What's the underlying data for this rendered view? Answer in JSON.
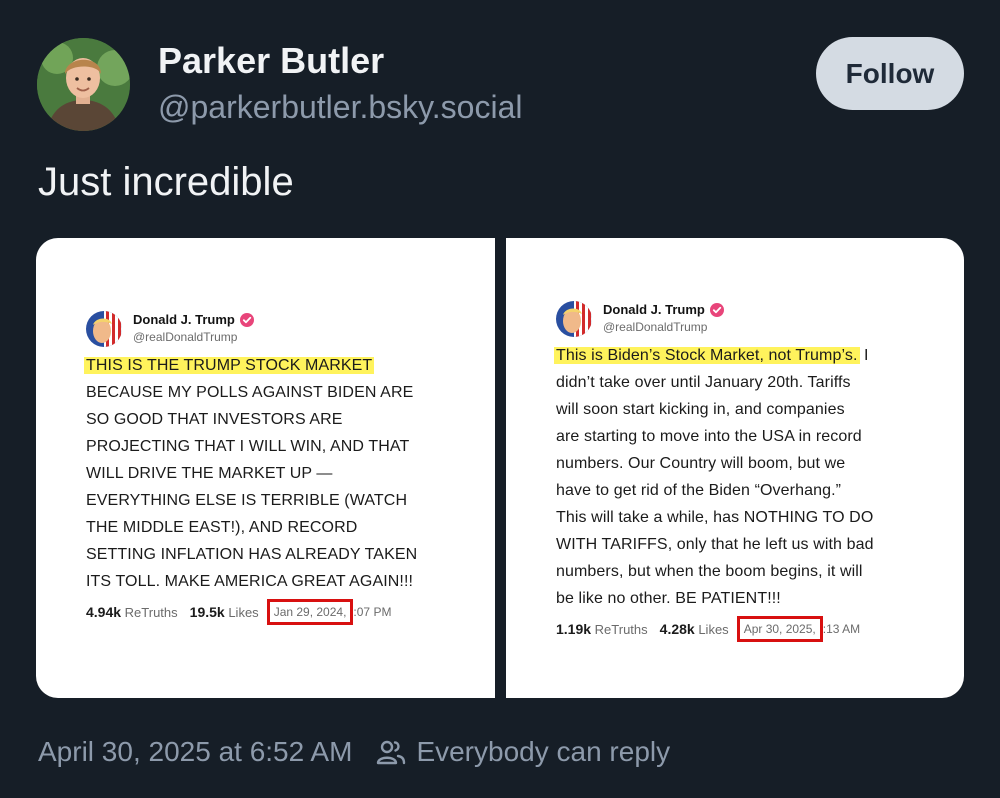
{
  "author": {
    "display_name": "Parker Butler",
    "handle": "@parkerbutler.bsky.social"
  },
  "follow_label": "Follow",
  "post_text": "Just incredible",
  "screenshots": [
    {
      "name": "Donald J. Trump",
      "handle": "@realDonaldTrump",
      "highlight": "THIS IS THE TRUMP STOCK MARKET",
      "body_lines": [
        "BECAUSE MY POLLS AGAINST BIDEN ARE",
        "SO GOOD THAT INVESTORS ARE",
        "PROJECTING THAT I WILL WIN, AND THAT",
        "WILL DRIVE THE MARKET UP —",
        "EVERYTHING ELSE IS TERRIBLE (WATCH",
        "THE MIDDLE EAST!), AND RECORD",
        "SETTING INFLATION HAS ALREADY TAKEN",
        "ITS TOLL. MAKE AMERICA GREAT AGAIN!!!"
      ],
      "retruths_count": "4.94k",
      "retruths_label": "ReTruths",
      "likes_count": "19.5k",
      "likes_label": "Likes",
      "date": "Jan 29, 2024,",
      "time_visible": ":07 PM"
    },
    {
      "name": "Donald J. Trump",
      "handle": "@realDonaldTrump",
      "highlight": "This is Biden’s Stock Market, not Trump’s.",
      "highlight_tail": " I",
      "body_lines": [
        "didn’t take over until January 20th. Tariffs",
        "will soon start kicking in, and companies",
        "are starting to move into the USA in record",
        "numbers. Our Country will boom, but we",
        "have to get rid of the Biden “Overhang.”",
        "This will take a while, has NOTHING TO DO",
        "WITH TARIFFS, only that he left us with bad",
        "numbers, but when the boom begins, it will",
        "be like no other. BE PATIENT!!!"
      ],
      "retruths_count": "1.19k",
      "retruths_label": "ReTruths",
      "likes_count": "4.28k",
      "likes_label": "Likes",
      "date": "Apr 30, 2025,",
      "time_visible": ":13 AM"
    }
  ],
  "footer": {
    "timestamp": "April 30, 2025 at 6:52 AM",
    "reply_setting": "Everybody can reply"
  },
  "colors": {
    "background": "#161e27",
    "follow_button": "#d4dbe3",
    "highlight": "#fff35c",
    "date_box": "#d81010",
    "verified": "#e8457a"
  },
  "icons": [
    "profile-avatar",
    "verified-badge-icon",
    "people-icon"
  ]
}
